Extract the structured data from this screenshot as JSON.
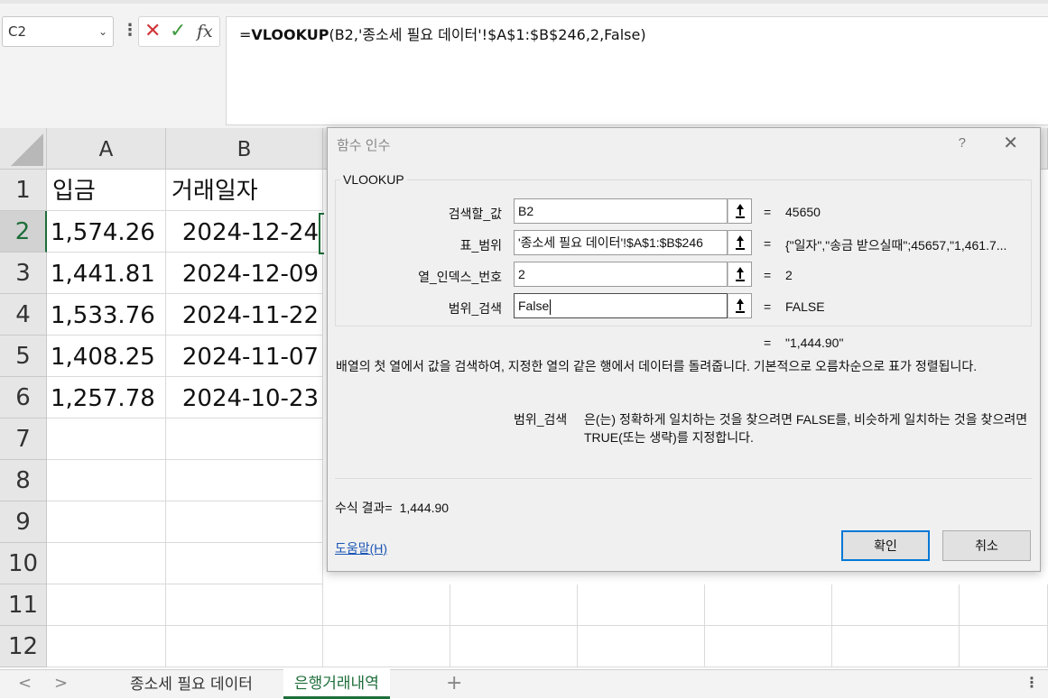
{
  "formula_bar": {
    "name_box": "C2",
    "cancel_icon": "✕",
    "enter_icon": "✓",
    "fx_label": "fx",
    "formula_prefix": "=",
    "formula_fn": "VLOOKUP",
    "formula_args": "(B2,'종소세 필요 데이터'!$A$1:$B$246,2,False)"
  },
  "grid": {
    "columns": [
      "A",
      "B"
    ],
    "row_numbers": [
      "1",
      "2",
      "3",
      "4",
      "5",
      "6",
      "7",
      "8",
      "9",
      "10",
      "11",
      "12"
    ],
    "rows": [
      {
        "a": "입금",
        "b": "거래일자"
      },
      {
        "a": "1,574.26",
        "b": "2024-12-24"
      },
      {
        "a": "1,441.81",
        "b": "2024-12-09"
      },
      {
        "a": "1,533.76",
        "b": "2024-11-22"
      },
      {
        "a": "1,408.25",
        "b": "2024-11-07"
      },
      {
        "a": "1,257.78",
        "b": "2024-10-23"
      }
    ]
  },
  "sheet_tabs": {
    "tabs": [
      "종소세 필요 데이터",
      "은행거래내역"
    ],
    "active": "은행거래내역",
    "add": "+",
    "prev": "<",
    "next": ">",
    "more": "⋮"
  },
  "dialog": {
    "title": "함수 인수",
    "help_glyph": "?",
    "close_glyph": "✕",
    "function_name": "VLOOKUP",
    "args": [
      {
        "label": "검색할_값",
        "value": "B2",
        "eq": "=",
        "result": "45650"
      },
      {
        "label": "표_범위",
        "value": "'종소세 필요 데이터'!$A$1:$B$246",
        "eq": "=",
        "result": "{\"일자\",\"송금 받으실때\";45657,\"1,461.7..."
      },
      {
        "label": "열_인덱스_번호",
        "value": "2",
        "eq": "=",
        "result": "2"
      },
      {
        "label": "범위_검색",
        "value": "False",
        "eq": "=",
        "result": "FALSE"
      }
    ],
    "overall_eq": "=",
    "overall_result": "\"1,444.90\"",
    "description": "배열의 첫 열에서 값을 검색하여, 지정한 열의 같은 행에서 데이터를 돌려줍니다. 기본적으로 오름차순으로 표가 정렬됩니다.",
    "arg_desc_name": "범위_검색",
    "arg_desc": "은(는) 정확하게 일치하는 것을 찾으려면 FALSE를, 비슷하게 일치하는 것을 찾으려면 TRUE(또는 생략)를 지정합니다.",
    "formula_result_label": "수식 결과=",
    "formula_result_value": "1,444.90",
    "help_link": "도움말(H)",
    "ok_label": "확인",
    "cancel_label": "취소"
  }
}
